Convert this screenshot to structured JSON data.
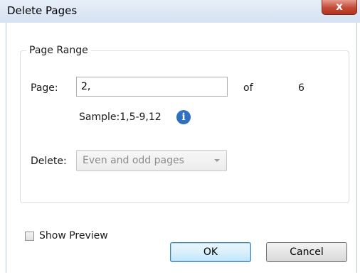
{
  "window": {
    "title": "Delete Pages",
    "close_glyph": "x"
  },
  "page_range": {
    "legend": "Page Range",
    "page_label": "Page:",
    "page_value": "2,",
    "of_label": "of",
    "total_pages": "6",
    "sample_text": "Sample:1,5-9,12",
    "info_glyph": "i",
    "delete_label": "Delete:",
    "delete_selected": "Even and odd pages"
  },
  "footer": {
    "show_preview_label": "Show Preview",
    "show_preview_checked": false,
    "ok_label": "OK",
    "cancel_label": "Cancel"
  },
  "colors": {
    "title_bar": "#d6e2f2",
    "close_button": "#c24a37",
    "info_icon": "#2f6fc4",
    "ok_button_border": "#3c7fb1"
  },
  "icons": {
    "close": "close-icon",
    "info": "info-icon",
    "dropdown": "chevron-down-icon"
  }
}
